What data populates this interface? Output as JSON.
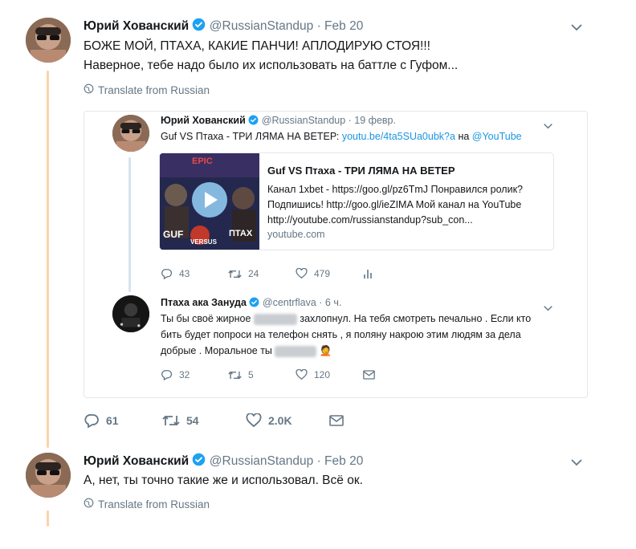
{
  "tweet1": {
    "name": "Юрий Хованский",
    "handle": "@RussianStandup",
    "date": "· Feb 20",
    "line1": "БОЖЕ МОЙ, ПТАХА, КАКИЕ ПАНЧИ! АПЛОДИРУЮ СТОЯ!!!",
    "line2": "Наверное, тебе надо было их использовать на баттле с Гуфом...",
    "translate": "Translate from Russian",
    "replies": "61",
    "retweets": "54",
    "likes": "2.0K"
  },
  "quote1": {
    "name": "Юрий Хованский",
    "handle": "@RussianStandup",
    "date": "· 19 февр.",
    "text_prefix": "Guf VS Птаха - ТРИ ЛЯМА НА ВЕТЕР:",
    "link": "youtu.be/4ta5SUa0ubk?a",
    "text_mid": "на",
    "mention": "@YouTube",
    "replies": "43",
    "retweets": "24",
    "likes": "479"
  },
  "card": {
    "title": "Guf VS Птаха - ТРИ ЛЯМА НА ВЕТЕР",
    "description": "Канал 1xbet - https://goo.gl/pz6TmJ Понравился ролик? Подпишись! http://goo.gl/ieZIMA Мой канал на YouTube http://youtube.com/russianstandup?sub_con...",
    "domain": "youtube.com",
    "thumb_left": "GUF",
    "thumb_right": "ПТАХ",
    "thumb_center": "VERSUS",
    "thumb_top": "EPIC"
  },
  "quote2": {
    "name": "Птаха ака Зануда",
    "handle": "@centrflava",
    "date": "· 6 ч.",
    "line1a": "Ты бы своё жирное",
    "line1b": "захлопнул. На тебя смотреть печально . Если кто",
    "line2": "бить будет попроси на телефон снять , я поляну накрою  этим людям за дела",
    "line3": "добрые . Моральное ты",
    "emoji": "🤦",
    "replies": "32",
    "retweets": "5",
    "likes": "120"
  },
  "tweet2": {
    "name": "Юрий Хованский",
    "handle": "@RussianStandup",
    "date": "· Feb 20",
    "line1": "А, нет, ты точно такие же и использовал. Всё ок.",
    "translate": "Translate from Russian"
  },
  "colors": {
    "verified": "#1da1f2",
    "link": "#1b95e0",
    "thread": "#fbd3a8",
    "muted": "#657786"
  }
}
